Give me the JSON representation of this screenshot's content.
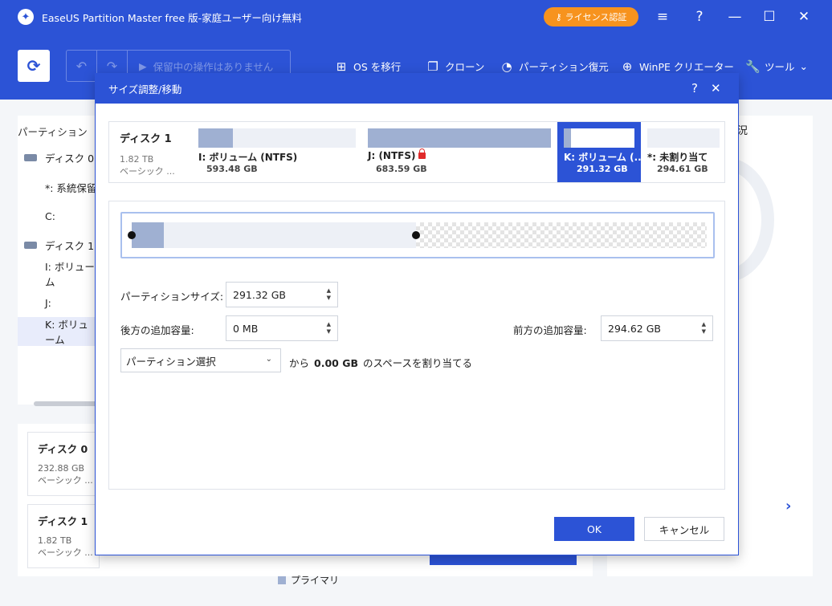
{
  "app": {
    "title": "EaseUS Partition Master free 版-家庭ユーザー向け無料",
    "license_label": "ライセンス認証"
  },
  "toolbar": {
    "pending_label": "保留中の操作はありません",
    "tools": [
      {
        "label": "OS を移行",
        "icon": "windows-icon"
      },
      {
        "label": "クローン",
        "icon": "clone-icon"
      },
      {
        "label": "パーティション復元",
        "icon": "pie-icon"
      },
      {
        "label": "WinPE クリエーター",
        "icon": "plus-circle-icon"
      },
      {
        "label": "ツール",
        "icon": "wrench-icon"
      }
    ]
  },
  "left_panel": {
    "header": "パーティション",
    "rows": [
      {
        "label": "ディスク 0"
      },
      {
        "label": "*: 系統保留"
      },
      {
        "label": "C:"
      },
      {
        "label": "ディスク 1"
      },
      {
        "label": "I: ボリューム"
      },
      {
        "label": "J:"
      },
      {
        "label": "K: ボリューム"
      }
    ]
  },
  "bottom_cards": [
    {
      "title": "ディスク 0",
      "size": "232.88 GB",
      "type": "ベーシック ..."
    },
    {
      "title": "ディスク 1",
      "size": "1.82 TB",
      "type": "ベーシック ..."
    }
  ],
  "legend": {
    "primary": "プライマリ"
  },
  "right_panel": {
    "title_fragment": "況"
  },
  "dialog": {
    "title": "サイズ調整/移動",
    "disk": {
      "title": "ディスク 1",
      "size": "1.82 TB",
      "type": "ベーシック ..."
    },
    "partitions": [
      {
        "name": "I: ボリューム (NTFS)",
        "size": "593.48 GB",
        "used_fraction": 0.22
      },
      {
        "name": "J: (NTFS)",
        "size": "683.59 GB",
        "used_fraction": 1.0
      },
      {
        "name": "K: ボリューム (..",
        "size": "291.32 GB",
        "used_fraction": 0.1
      },
      {
        "name": "*: 未割り当て",
        "size": "294.61 GB"
      }
    ],
    "fields": {
      "partition_size_label": "パーティションサイズ:",
      "partition_size_value": "291.32 GB",
      "after_label": "後方の追加容量:",
      "after_value": "0 MB",
      "before_label": "前方の追加容量:",
      "before_value": "294.62 GB"
    },
    "allocate": {
      "select_label": "パーティション選択",
      "from_text": "から",
      "amount": "0.00 GB",
      "suffix_text": "のスペースを割り当てる"
    },
    "ok_label": "OK",
    "cancel_label": "キャンセル"
  }
}
